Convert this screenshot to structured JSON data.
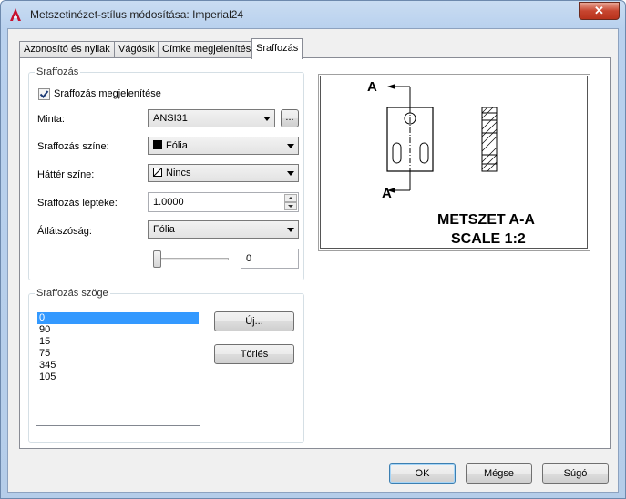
{
  "window": {
    "title": "Metszetinézet-stílus módosítása: Imperial24",
    "close_label": "✕"
  },
  "tabs": [
    {
      "label": "Azonosító és nyilak"
    },
    {
      "label": "Vágósík"
    },
    {
      "label": "Címke megjelenítése"
    },
    {
      "label": "Sraffozás"
    }
  ],
  "hatch_group": {
    "title": "Sraffozás",
    "show_hatch": {
      "label": "Sraffozás megjelenítése",
      "checked": true
    },
    "pattern": {
      "label": "Minta:",
      "value": "ANSI31",
      "browse_label": "..."
    },
    "hatch_color": {
      "label": "Sraffozás színe:",
      "value": "Fólia",
      "swatch": "#000000"
    },
    "bg_color": {
      "label": "Háttér színe:",
      "value": "Nincs"
    },
    "scale": {
      "label": "Sraffozás léptéke:",
      "value": "1.0000"
    },
    "transparency": {
      "label": "Átlátszóság:",
      "value": "Fólia",
      "slider_value": "0"
    }
  },
  "angle_group": {
    "title": "Sraffozás szöge",
    "angles": [
      "0",
      "90",
      "15",
      "75",
      "345",
      "105"
    ],
    "selected_index": 0,
    "new_label": "Új...",
    "delete_label": "Törlés"
  },
  "preview": {
    "label_top": "A",
    "label_bottom": "A",
    "caption_line1": "METSZET A-A",
    "caption_line2": "SCALE 1:2"
  },
  "footer": {
    "ok_label": "OK",
    "cancel_label": "Mégse",
    "help_label": "Súgó"
  },
  "colors": {
    "accent": "#3399ff",
    "close_button": "#c7452f"
  }
}
